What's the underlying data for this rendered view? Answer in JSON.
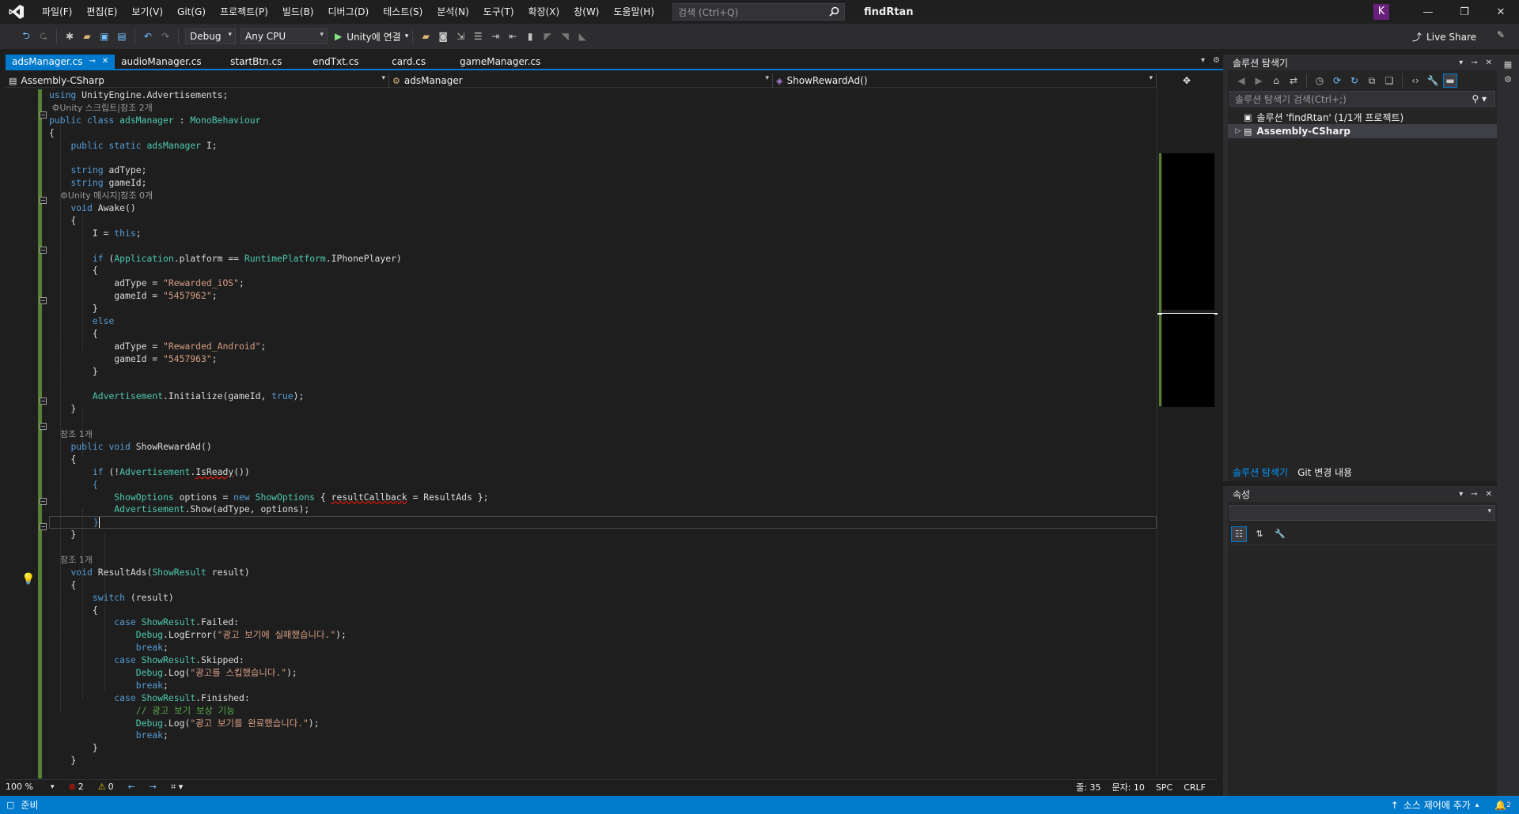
{
  "menu": {
    "items": [
      "파일(F)",
      "편집(E)",
      "보기(V)",
      "Git(G)",
      "프로젝트(P)",
      "빌드(B)",
      "디버그(D)",
      "테스트(S)",
      "분석(N)",
      "도구(T)",
      "확장(X)",
      "창(W)",
      "도움말(H)"
    ],
    "search_placeholder": "검색 (Ctrl+Q)",
    "solution_title": "findRtan",
    "avatar_letter": "K"
  },
  "toolbar": {
    "config": "Debug",
    "platform": "Any CPU",
    "run_label": "Unity에 연결",
    "live_share": "Live Share"
  },
  "tabs": {
    "active": "adsManager.cs",
    "others": [
      "audioManager.cs",
      "startBtn.cs",
      "endTxt.cs",
      "card.cs",
      "gameManager.cs"
    ]
  },
  "navbar": {
    "project": "Assembly-CSharp",
    "class": "adsManager",
    "member": "ShowRewardAd()"
  },
  "code": {
    "l1_using": "using",
    "l1_ns": " UnityEngine.Advertisements;",
    "lens1": "⚙Unity 스크립트|참조 2개",
    "lens2": "⚙Unity 메시지|참조 0개",
    "lens3": "참조 1개",
    "lens4": "참조 1개",
    "class_name": "adsManager",
    "base_class": "MonoBehaviour",
    "s_rewarded_ios": "\"Rewarded_iOS\"",
    "s_game_id_ios": "\"5457962\"",
    "s_rewarded_android": "\"Rewarded_Android\"",
    "s_game_id_android": "\"5457963\"",
    "s_err_failed": "\"광고 보기에 실패했습니다.\"",
    "s_err_skipped": "\"광고를 스킵했습니다.\"",
    "s_err_finished": "\"광고 보기를 완료했습니다.\"",
    "comment_reward": "// 광고 보기 보상 기능"
  },
  "editor_status": {
    "zoom": "100 %",
    "errors": "2",
    "warnings": "0",
    "line": "줄: 35",
    "col": "문자: 10",
    "spc": "SPC",
    "eol": "CRLF"
  },
  "solution_explorer": {
    "title": "솔루션 탐색기",
    "search_placeholder": "솔루션 탐색기 검색(Ctrl+;)",
    "solution_node": "솔루션 'findRtan' (1/1개 프로젝트)",
    "project_node": "Assembly-CSharp",
    "tab_active": "솔루션 탐색기",
    "tab_git": "Git 변경 내용"
  },
  "properties": {
    "title": "속성"
  },
  "statusbar": {
    "ready": "준비",
    "source_control": "소스 제어에 추가",
    "notifications": "2"
  },
  "colors": {
    "accent": "#007acc",
    "keyword": "#569cd6",
    "type": "#4ec9b0",
    "string": "#d69d85",
    "comment": "#57a64a"
  }
}
